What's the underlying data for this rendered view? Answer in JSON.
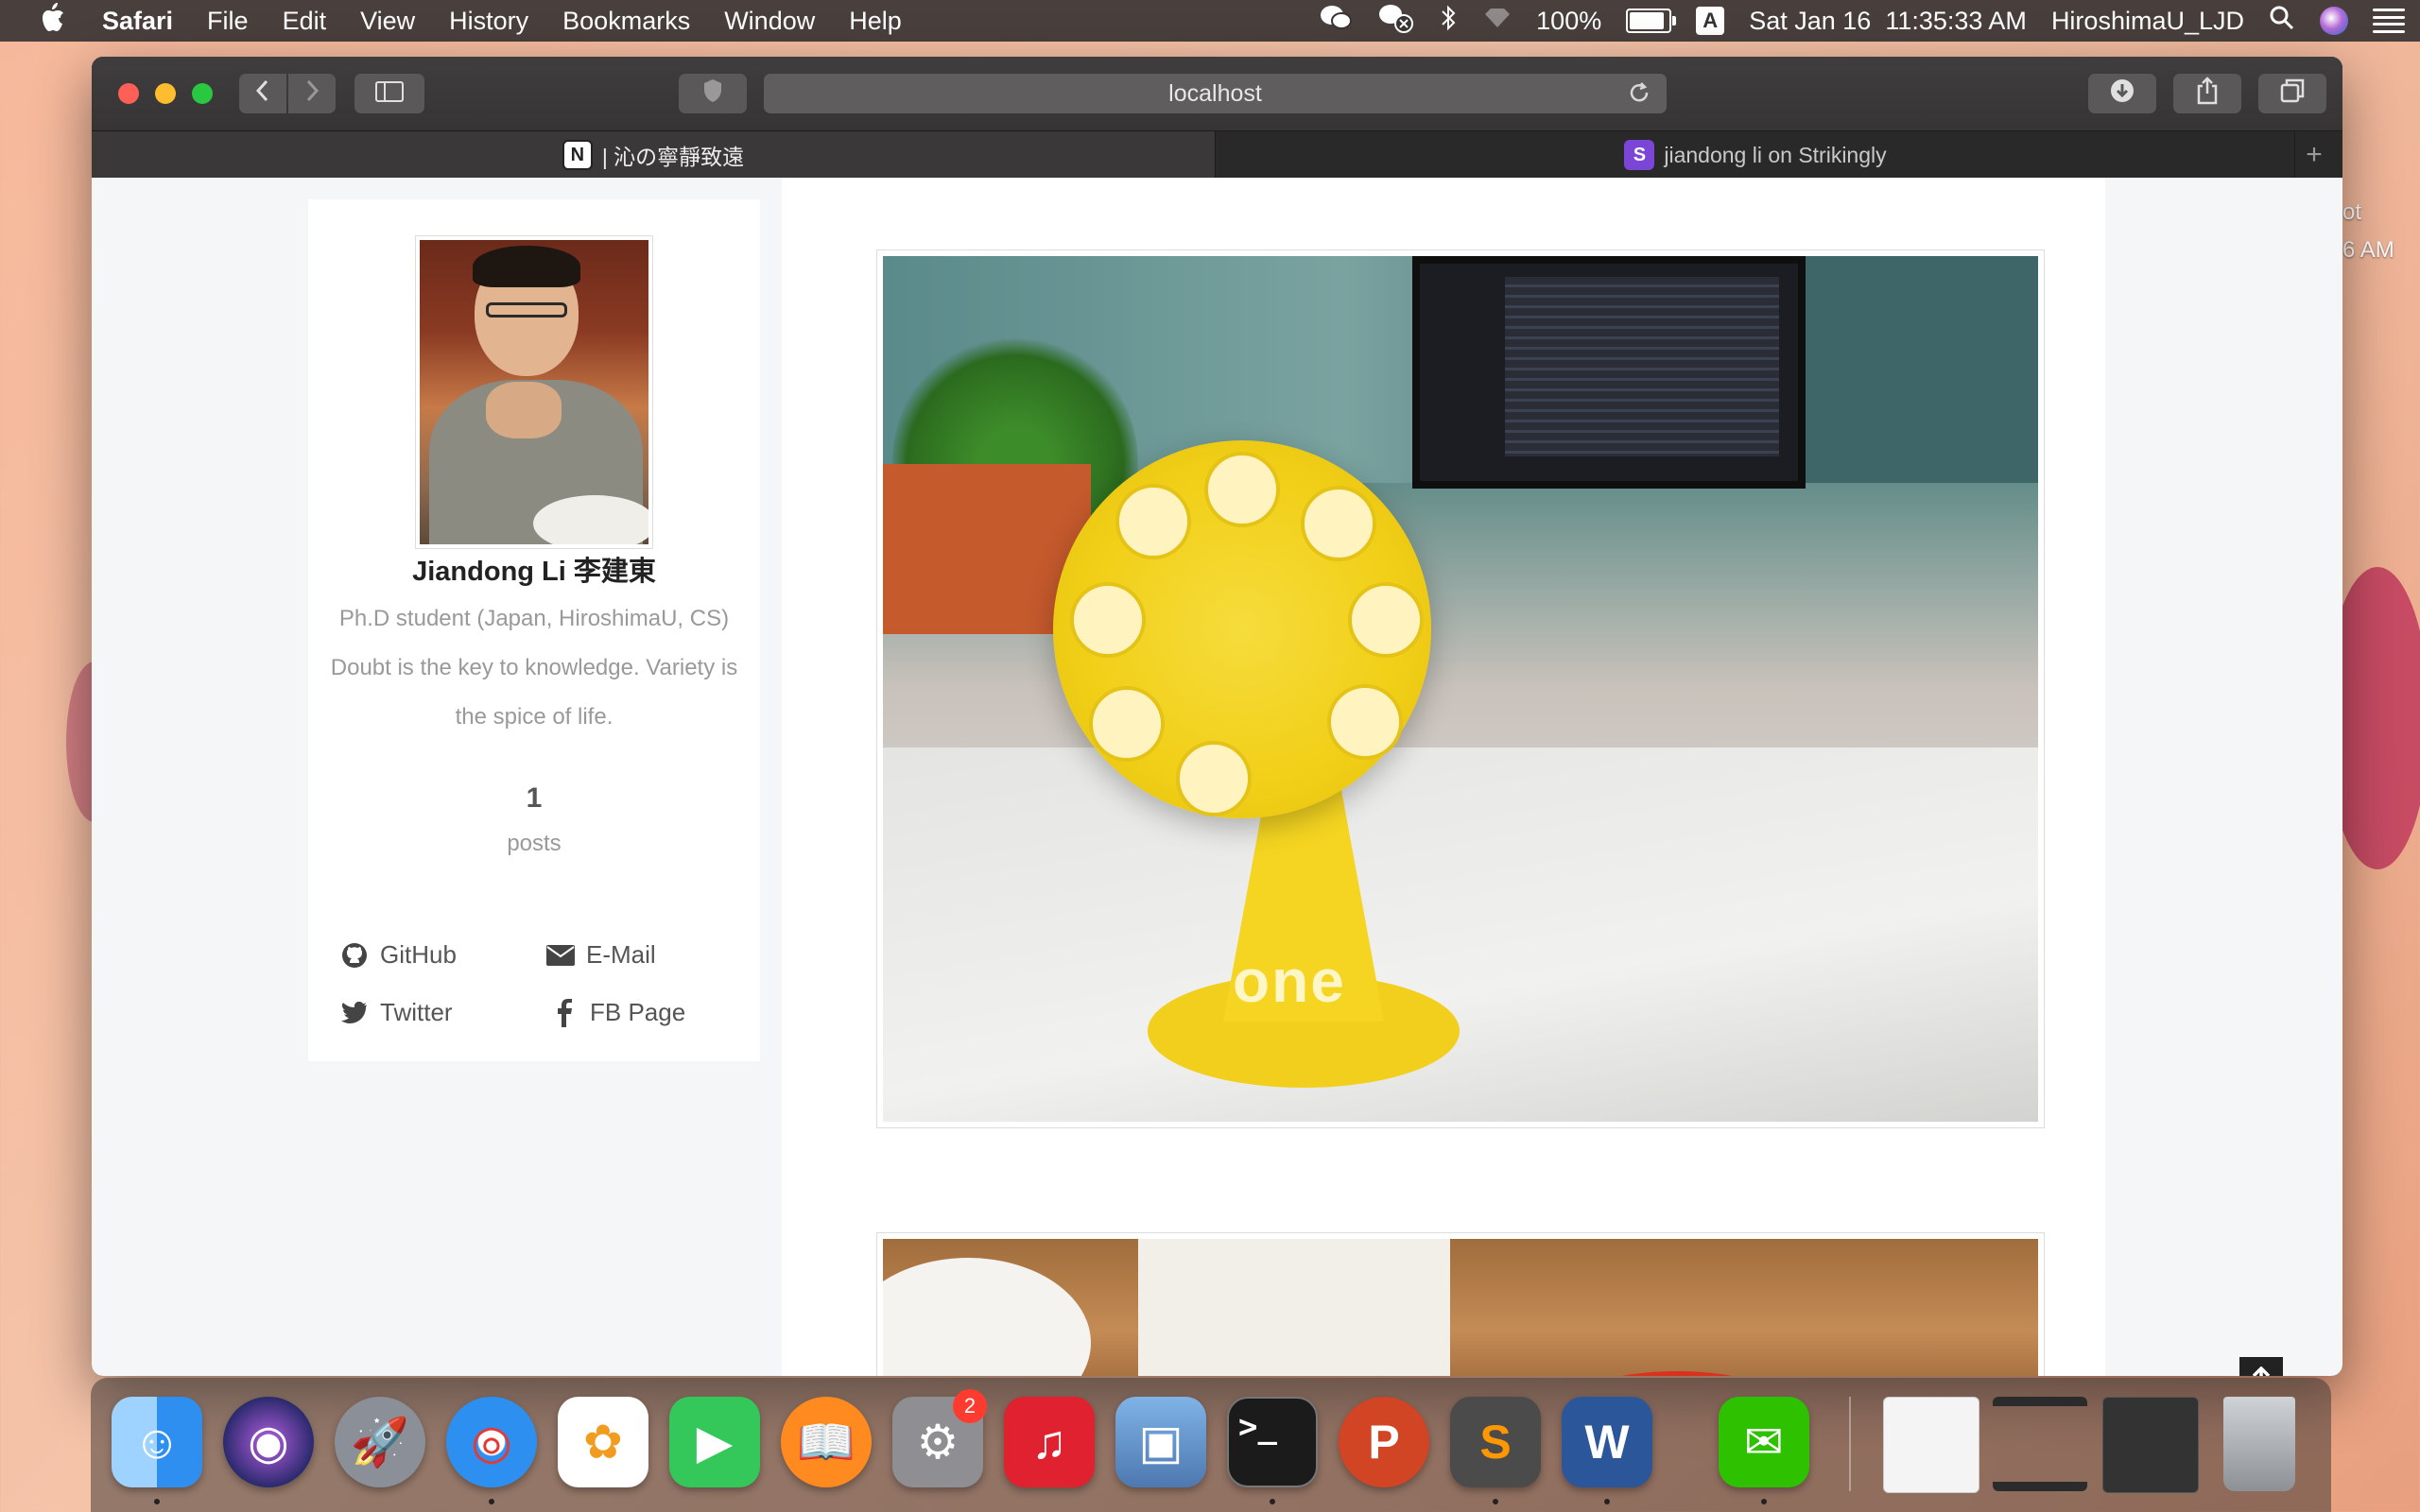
{
  "menubar": {
    "app_name": "Safari",
    "menus": [
      "File",
      "Edit",
      "View",
      "History",
      "Bookmarks",
      "Window",
      "Help"
    ],
    "battery": "100%",
    "input_source": "A",
    "datetime": "Sat Jan 16  11:35:33 AM",
    "user": "HiroshimaU_LJD"
  },
  "desktop": {
    "partial_text_1": "ot",
    "partial_text_2": "6 AM"
  },
  "safari": {
    "address": "localhost",
    "tabs": [
      {
        "favicon": "N",
        "title": "| 沁の寧靜致遠",
        "active": true
      },
      {
        "favicon": "S",
        "title": "jiandong li on Strikingly",
        "active": false
      }
    ],
    "new_tab_label": "+"
  },
  "profile": {
    "name": "Jiandong Li 李建東",
    "description": "Ph.D student (Japan, HiroshimaU, CS) Doubt is the key to knowledge. Variety is the spice of life.",
    "posts_count": "1",
    "posts_label": "posts",
    "links": {
      "github": "GitHub",
      "email": "E-Mail",
      "twitter": "Twitter",
      "fb": "FB Page"
    }
  },
  "photo": {
    "brand_text": "one"
  },
  "dock": {
    "apps": [
      {
        "name": "Finder",
        "color": "#2e8ff0",
        "glyph": "☺"
      },
      {
        "name": "Siri",
        "color": "#2b2a6e",
        "glyph": "◉"
      },
      {
        "name": "Launchpad",
        "color": "#8a8f98",
        "glyph": "🚀"
      },
      {
        "name": "Safari",
        "color": "#2d8ff0",
        "glyph": "◎"
      },
      {
        "name": "Photos",
        "color": "#ffffff",
        "glyph": "✿"
      },
      {
        "name": "FaceTime",
        "color": "#34c759",
        "glyph": "▶"
      },
      {
        "name": "Books",
        "color": "#ff8a1f",
        "glyph": "📖"
      },
      {
        "name": "System Preferences",
        "color": "#8e8e93",
        "glyph": "⚙"
      },
      {
        "name": "NetEase Music",
        "color": "#e0212f",
        "glyph": "♫"
      },
      {
        "name": "Preview",
        "color": "#5a8cc8",
        "glyph": "▣"
      },
      {
        "name": "Terminal",
        "color": "#1b1b1b",
        "glyph": ">_"
      },
      {
        "name": "PowerPoint",
        "color": "#d14424",
        "glyph": "P"
      },
      {
        "name": "Sublime Text",
        "color": "#4b4b4b",
        "glyph": "S"
      },
      {
        "name": "Word",
        "color": "#2b579a",
        "glyph": "W"
      },
      {
        "name": "WeChat",
        "color": "#2dc100",
        "glyph": "✉"
      }
    ],
    "system_prefs_badge": "2"
  }
}
